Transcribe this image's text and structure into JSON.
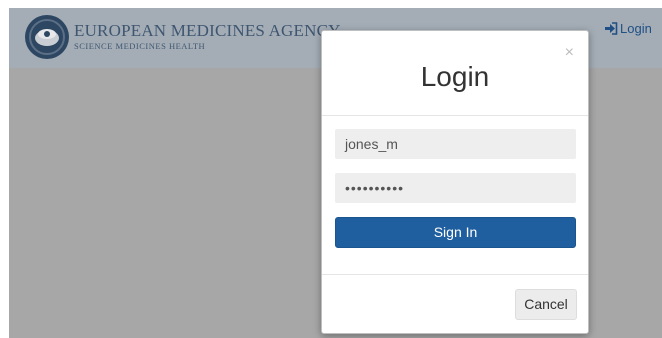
{
  "header": {
    "logo_title": "EUROPEAN MEDICINES AGENCY",
    "logo_subtitle": "SCIENCE  MEDICINES  HEALTH",
    "login_link": "Login",
    "login_icon": "sign-in-icon",
    "logo_icon": "ema-emblem-icon"
  },
  "modal": {
    "title": "Login",
    "close_symbol": "×",
    "username_value": "jones_m",
    "password_value": "••••••••••",
    "sign_in_label": "Sign In",
    "cancel_label": "Cancel"
  },
  "colors": {
    "backdrop": "#a7a7a7",
    "header": "#a4adb6",
    "primary_button": "#1f5fa0",
    "link": "#1f4f84"
  }
}
